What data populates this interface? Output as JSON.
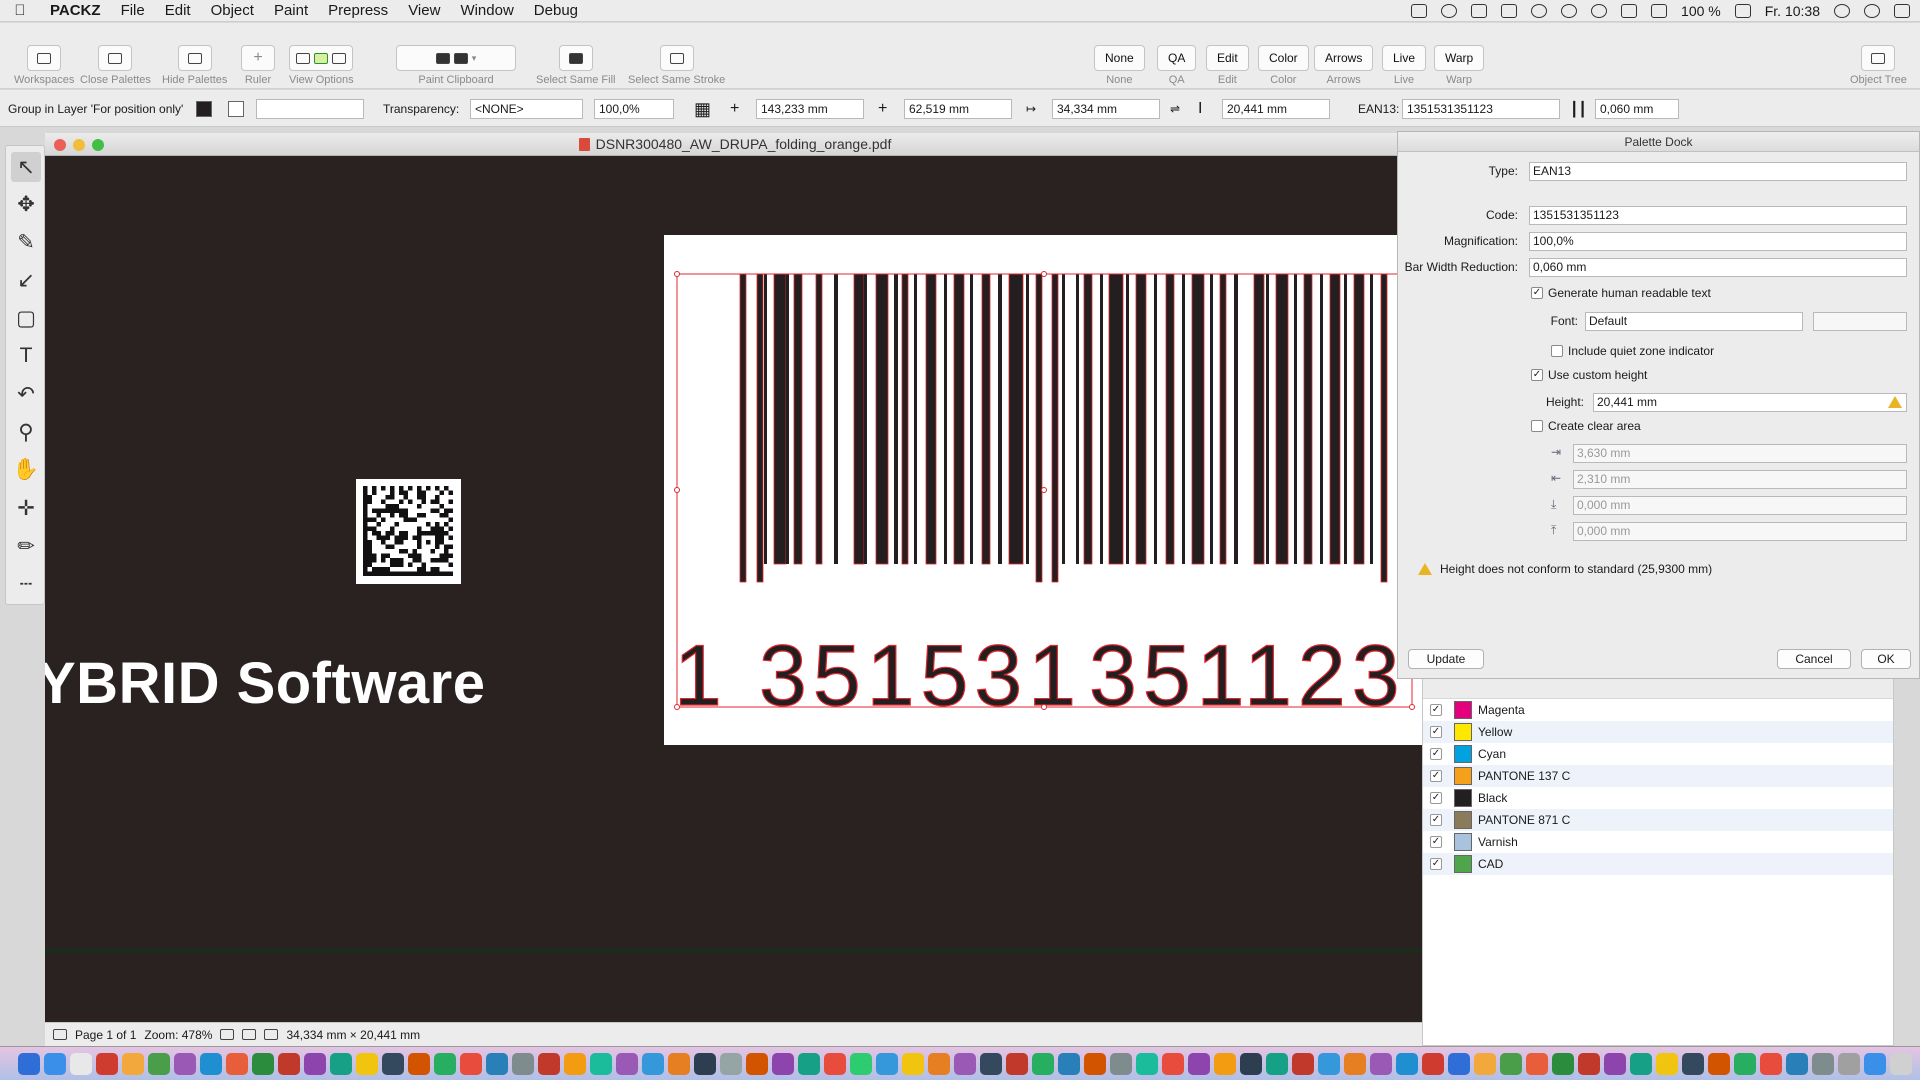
{
  "menubar": {
    "app": "PACKZ",
    "items": [
      "File",
      "Edit",
      "Object",
      "Paint",
      "Prepress",
      "View",
      "Window",
      "Debug"
    ],
    "battery": "100 %",
    "clock": "Fr. 10:38"
  },
  "toolbar": {
    "workspaces": "Workspaces",
    "close_palettes": "Close Palettes",
    "hide_palettes": "Hide Palettes",
    "ruler": "Ruler",
    "view_options": "View Options",
    "paint_clipboard": "Paint Clipboard",
    "select_same_fill": "Select Same Fill",
    "select_same_stroke": "Select Same Stroke",
    "none": "None",
    "qa": "QA",
    "edit": "Edit",
    "color": "Color",
    "arrows": "Arrows",
    "live": "Live",
    "warp": "Warp",
    "object_tree": "Object Tree"
  },
  "propbar": {
    "layer_info": "Group in Layer 'For position only'",
    "transparency_label": "Transparency:",
    "blend_mode": "<NONE>",
    "opacity": "100,0%",
    "x": "143,233 mm",
    "y": "62,519 mm",
    "width": "34,334 mm",
    "height": "20,441 mm",
    "barcode_label": "EAN13:",
    "barcode_code": "1351531351123",
    "bar_width_reduction": "0,060 mm"
  },
  "document": {
    "title": "DSNR300480_AW_DRUPA_folding_orange.pdf",
    "company_text": "YBRID Software",
    "barcode_digits": [
      "1",
      "351531",
      "351123"
    ],
    "status": {
      "page": "Page 1 of 1",
      "zoom": "Zoom: 478%",
      "dimensions": "34,334 mm × 20,441 mm"
    }
  },
  "palette": {
    "title": "Palette Dock",
    "type_label": "Type:",
    "type_value": "EAN13",
    "code_label": "Code:",
    "code_value": "1351531351123",
    "magnification_label": "Magnification:",
    "magnification_value": "100,0%",
    "bwr_label": "Bar Width Reduction:",
    "bwr_value": "0,060 mm",
    "generate_text_label": "Generate human readable text",
    "font_label": "Font:",
    "font_value": "Default",
    "quiet_zone_label": "Include quiet zone indicator",
    "custom_height_label": "Use custom height",
    "height_label": "Height:",
    "height_value": "20,441 mm",
    "clear_area_label": "Create clear area",
    "clear_area_values": [
      "3,630 mm",
      "2,310 mm",
      "0,000 mm",
      "0,000 mm"
    ],
    "warning": "Height does not conform to standard (25,9300 mm)",
    "update_button": "Update",
    "cancel_button": "Cancel",
    "ok_button": "OK"
  },
  "separations": {
    "items": [
      {
        "name": "Magenta",
        "color": "#e5007e"
      },
      {
        "name": "Yellow",
        "color": "#ffe800"
      },
      {
        "name": "Cyan",
        "color": "#00a3e0"
      },
      {
        "name": "PANTONE 137 C",
        "color": "#f5a01a"
      },
      {
        "name": "Black",
        "color": "#231f20"
      },
      {
        "name": "PANTONE 871 C",
        "color": "#8b7b5a"
      },
      {
        "name": "Varnish",
        "color": "#a9c3df"
      },
      {
        "name": "CAD",
        "color": "#4fa64a"
      }
    ]
  }
}
